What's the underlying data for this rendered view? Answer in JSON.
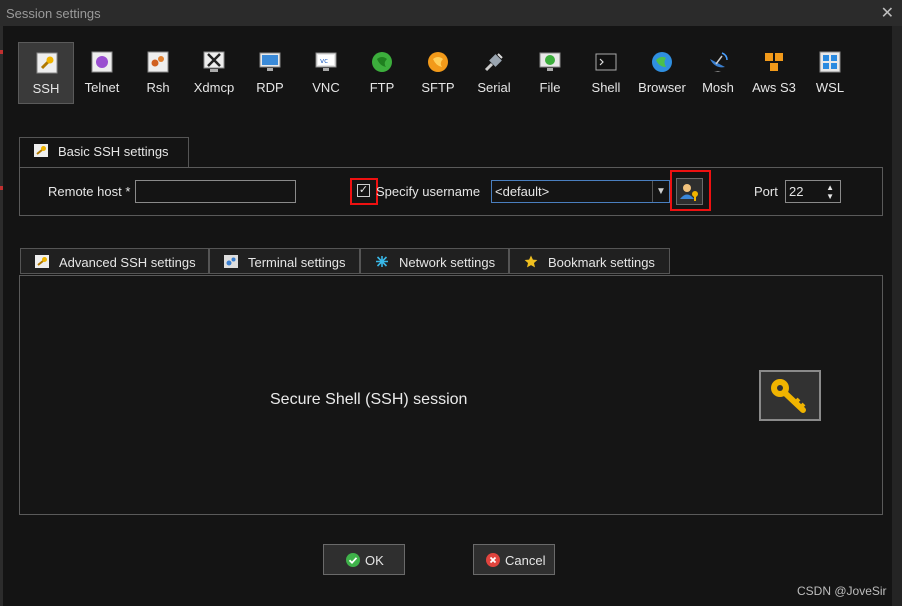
{
  "window": {
    "title": "Session settings"
  },
  "session_types": [
    {
      "label": "SSH",
      "icon": "wrench-icon",
      "active": true
    },
    {
      "label": "Telnet",
      "icon": "telnet-icon"
    },
    {
      "label": "Rsh",
      "icon": "rsh-icon"
    },
    {
      "label": "Xdmcp",
      "icon": "x-icon"
    },
    {
      "label": "RDP",
      "icon": "rdp-monitor-icon"
    },
    {
      "label": "VNC",
      "icon": "vnc-icon"
    },
    {
      "label": "FTP",
      "icon": "ftp-globe-icon"
    },
    {
      "label": "SFTP",
      "icon": "sftp-globe-icon"
    },
    {
      "label": "Serial",
      "icon": "serial-plug-icon"
    },
    {
      "label": "File",
      "icon": "file-monitor-icon"
    },
    {
      "label": "Shell",
      "icon": "terminal-icon"
    },
    {
      "label": "Browser",
      "icon": "browser-globe-icon"
    },
    {
      "label": "Mosh",
      "icon": "satellite-dish-icon"
    },
    {
      "label": "Aws S3",
      "icon": "aws-cubes-icon"
    },
    {
      "label": "WSL",
      "icon": "windows-icon"
    }
  ],
  "basic_tab": {
    "label": "Basic SSH settings"
  },
  "basic": {
    "remote_host_label": "Remote host *",
    "remote_host_value": "",
    "specify_username_label": "Specify username",
    "specify_username_checked": true,
    "username_value": "<default>",
    "port_label": "Port",
    "port_value": "22"
  },
  "sub_tabs": [
    {
      "label": "Advanced SSH settings",
      "icon": "wrench-icon"
    },
    {
      "label": "Terminal settings",
      "icon": "terminal-settings-icon"
    },
    {
      "label": "Network settings",
      "icon": "network-icon"
    },
    {
      "label": "Bookmark settings",
      "icon": "star-icon"
    }
  ],
  "panel": {
    "description": "Secure Shell (SSH) session"
  },
  "buttons": {
    "ok": "OK",
    "cancel": "Cancel"
  },
  "watermark": "CSDN @JoveSir",
  "colors": {
    "accent_blue": "#4a7fbf",
    "highlight_red": "#e11111",
    "ok_green": "#3fb24a",
    "cancel_red": "#e0443e",
    "key_gold": "#f0b400"
  }
}
